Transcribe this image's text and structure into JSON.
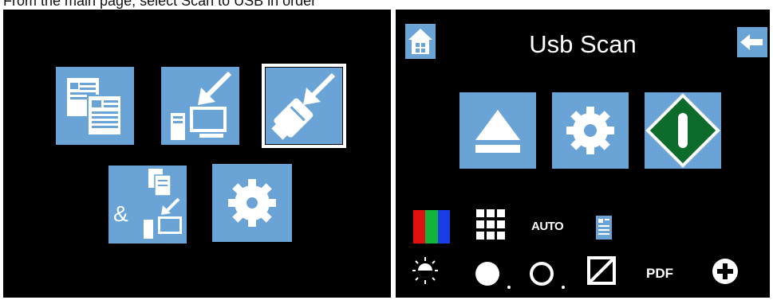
{
  "caption": "From the main page, select Scan to USB in order",
  "right_panel": {
    "title": "Usb Scan"
  },
  "left_panel": {
    "tiles": [
      {
        "icon": "documents-icon"
      },
      {
        "icon": "scan-to-pc-icon"
      },
      {
        "icon": "scan-to-usb-icon",
        "selected": true
      },
      {
        "icon": "scan-documents-and-pc-icon"
      },
      {
        "icon": "settings-gear-icon"
      }
    ]
  },
  "options_row1": {
    "auto_label": "AUTO"
  },
  "options_row2": {
    "pdf_label": "PDF"
  },
  "colors": {
    "panel_background": "#000000",
    "tile_blue": "#6aa3d6",
    "diamond_green": "#0b6b2a"
  }
}
